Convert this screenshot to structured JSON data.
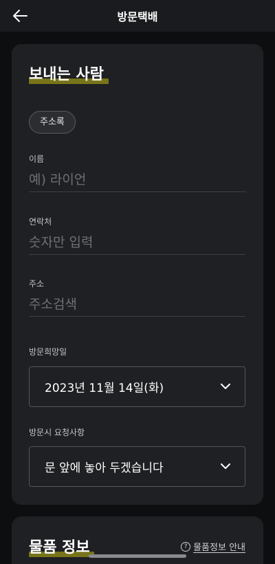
{
  "header": {
    "title": "방문택배",
    "back_icon": "arrow-left-icon"
  },
  "sender": {
    "title": "보내는 사람",
    "address_book_chip": "주소록",
    "name": {
      "label": "이름",
      "placeholder": "예) 라이언",
      "value": ""
    },
    "phone": {
      "label": "연락처",
      "placeholder": "숫자만 입력",
      "value": ""
    },
    "address": {
      "label": "주소",
      "placeholder": "주소검색",
      "value": ""
    },
    "visit_date": {
      "label": "방문희망일",
      "selected": "2023년 11월 14일(화)"
    },
    "visit_request": {
      "label": "방문시 요청사항",
      "selected": "문 앞에 놓아 두겠습니다"
    }
  },
  "item": {
    "title": "물품 정보",
    "info_link": "물품정보 안내",
    "info_icon": "question-circle-icon"
  },
  "colors": {
    "background": "#0d0e10",
    "card": "#1f2023",
    "highlight": "#77741a",
    "placeholder": "#6f7075"
  }
}
